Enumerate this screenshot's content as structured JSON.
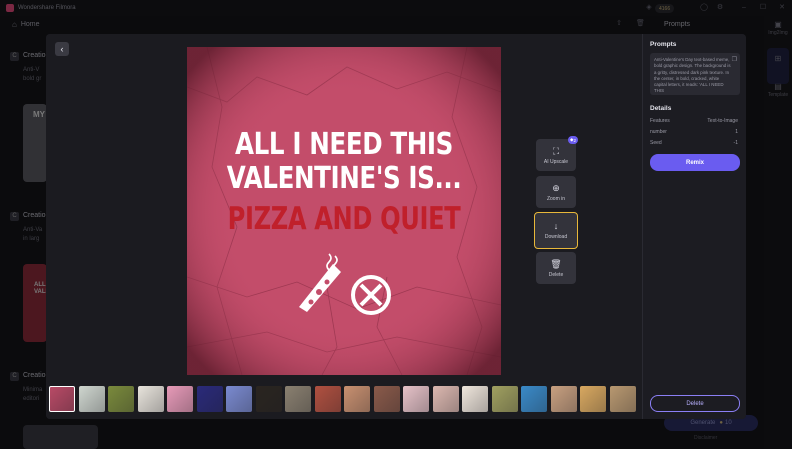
{
  "app": {
    "name": "Wondershare Filmora"
  },
  "titlebar": {
    "credits": "4166"
  },
  "home": {
    "label": "Home"
  },
  "background": {
    "prompt_header": "Prompts",
    "creations": [
      {
        "title": "Creatio",
        "text_lines": [
          "Anti-V",
          "bold gr"
        ]
      },
      {
        "title": "Creatio",
        "text_lines": [
          "Anti-Va",
          "in larg"
        ]
      },
      {
        "title": "Creatio",
        "text_lines": [
          "Minima",
          "editori"
        ]
      }
    ],
    "card_texts": [
      "MY",
      "ALL",
      "VALE"
    ],
    "generate_label": "Generate",
    "generate_cost": "10",
    "disclaimer": "Disclaimer"
  },
  "rail": {
    "items": [
      {
        "icon": "image-icon",
        "label": "Img2Img"
      },
      {
        "icon": "grid-icon",
        "label": ""
      },
      {
        "icon": "template-icon",
        "label": "Template"
      }
    ]
  },
  "image": {
    "line1": "ALL I NEED THIS",
    "line2": "VALENTINE'S IS...",
    "line3": "PIZZA AND QUIET"
  },
  "tools": {
    "upscale": {
      "label": "AI Upscale",
      "badge": "2"
    },
    "zoom": {
      "label": "Zoom in"
    },
    "download": {
      "label": "Download"
    },
    "delete": {
      "label": "Delete"
    }
  },
  "panel": {
    "prompts_title": "Prompts",
    "prompt_text": "Anti-Valentine's Day text-based meme, bold graphic design. The background is a gritty, distressed dark pink texture. In the center, in bold, cracked, white capital letters, it reads: 'ALL I NEED THIS",
    "details_title": "Details",
    "details": [
      {
        "key": "Features",
        "value": "Text-to-Image"
      },
      {
        "key": "number",
        "value": "1"
      },
      {
        "key": "Seed",
        "value": "-1"
      }
    ],
    "remix_label": "Remix",
    "delete_label": "Delete"
  },
  "thumbnails": [
    {
      "name": "valentine-meme",
      "color": "#b84a66"
    },
    {
      "name": "fog-landscape",
      "color": "#cfd6cf"
    },
    {
      "name": "forest-scene",
      "color": "#7a8a3c"
    },
    {
      "name": "card-design",
      "color": "#e8e4dc"
    },
    {
      "name": "pink-balloons",
      "color": "#e79ab8"
    },
    {
      "name": "neon-portal",
      "color": "#2a2a7a"
    },
    {
      "name": "orange-orb",
      "color": "#7a8ad0"
    },
    {
      "name": "dark-figures",
      "color": "#2a2520"
    },
    {
      "name": "doorway",
      "color": "#8a8070"
    },
    {
      "name": "red-room",
      "color": "#b05040"
    },
    {
      "name": "party-scene",
      "color": "#c89070"
    },
    {
      "name": "dining-room",
      "color": "#8a5a4a"
    },
    {
      "name": "baby-portrait",
      "color": "#e6c2c8"
    },
    {
      "name": "baby-bath",
      "color": "#dcb8b0"
    },
    {
      "name": "flower-wreath",
      "color": "#efe6dc"
    },
    {
      "name": "garden-figure",
      "color": "#a0a060"
    },
    {
      "name": "blue-pattern",
      "color": "#3a8ac8"
    },
    {
      "name": "kitten",
      "color": "#c8a080"
    },
    {
      "name": "golden-kitten",
      "color": "#d8a860"
    },
    {
      "name": "coffee-table",
      "color": "#b89870"
    }
  ]
}
